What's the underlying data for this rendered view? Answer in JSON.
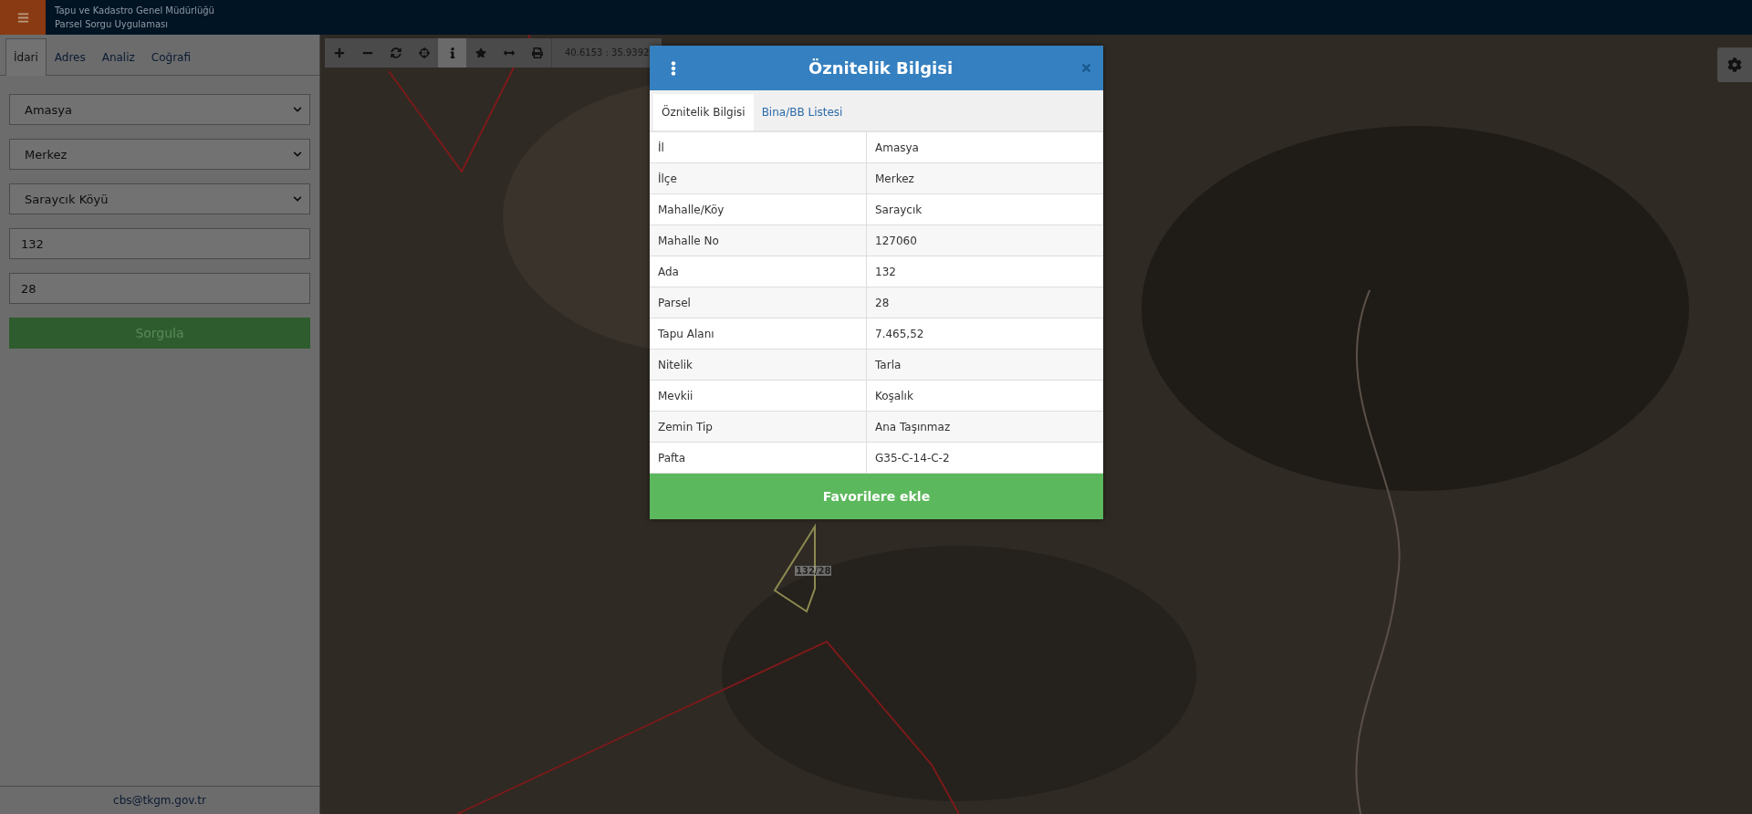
{
  "header": {
    "title_lines": [
      "Tapu ve Kadastro Genel Müdürlüğü",
      "Parsel Sorgu Uygulaması"
    ]
  },
  "sidebar": {
    "tabs": [
      {
        "label": "İdari",
        "selected": true
      },
      {
        "label": "Adres",
        "selected": false
      },
      {
        "label": "Analiz",
        "selected": false
      },
      {
        "label": "Coğrafi",
        "selected": false
      }
    ],
    "fields": [
      {
        "kind": "select",
        "value": "Amasya"
      },
      {
        "kind": "select",
        "value": "Merkez"
      },
      {
        "kind": "select",
        "value": "Saraycık Köyü"
      },
      {
        "kind": "input",
        "value": "132"
      },
      {
        "kind": "input",
        "value": "28"
      }
    ],
    "button": "Sorgula",
    "footer_email": "cbs@tkgm.gov.tr"
  },
  "map_toolbar": {
    "tools": [
      {
        "kind": "zoom-in",
        "selected": false
      },
      {
        "kind": "zoom-out",
        "selected": false
      },
      {
        "kind": "refresh",
        "selected": false
      },
      {
        "kind": "locate",
        "selected": false
      },
      {
        "kind": "info",
        "selected": true
      },
      {
        "kind": "favorite",
        "selected": false
      },
      {
        "kind": "measure",
        "selected": false
      },
      {
        "kind": "print",
        "selected": false
      }
    ],
    "coordinates": "40.6153 : 35.9392"
  },
  "map": {
    "parcel_label": "132/28"
  },
  "popup": {
    "title": "Öznitelik Bilgisi",
    "tabs": [
      {
        "label": "Öznitelik Bilgisi",
        "selected": true
      },
      {
        "label": "Bina/BB Listesi",
        "selected": false
      }
    ],
    "rows": [
      {
        "label": "İl",
        "value": "Amasya"
      },
      {
        "label": "İlçe",
        "value": "Merkez"
      },
      {
        "label": "Mahalle/Köy",
        "value": "Saraycık"
      },
      {
        "label": "Mahalle No",
        "value": "127060"
      },
      {
        "label": "Ada",
        "value": "132"
      },
      {
        "label": "Parsel",
        "value": "28"
      },
      {
        "label": "Tapu Alanı",
        "value": "7.465,52"
      },
      {
        "label": "Nitelik",
        "value": "Tarla"
      },
      {
        "label": "Mevkii",
        "value": "Koşalık"
      },
      {
        "label": "Zemin Tip",
        "value": "Ana Taşınmaz"
      },
      {
        "label": "Pafta",
        "value": "G35-C-14-C-2"
      }
    ],
    "action": "Favorilere ekle"
  }
}
